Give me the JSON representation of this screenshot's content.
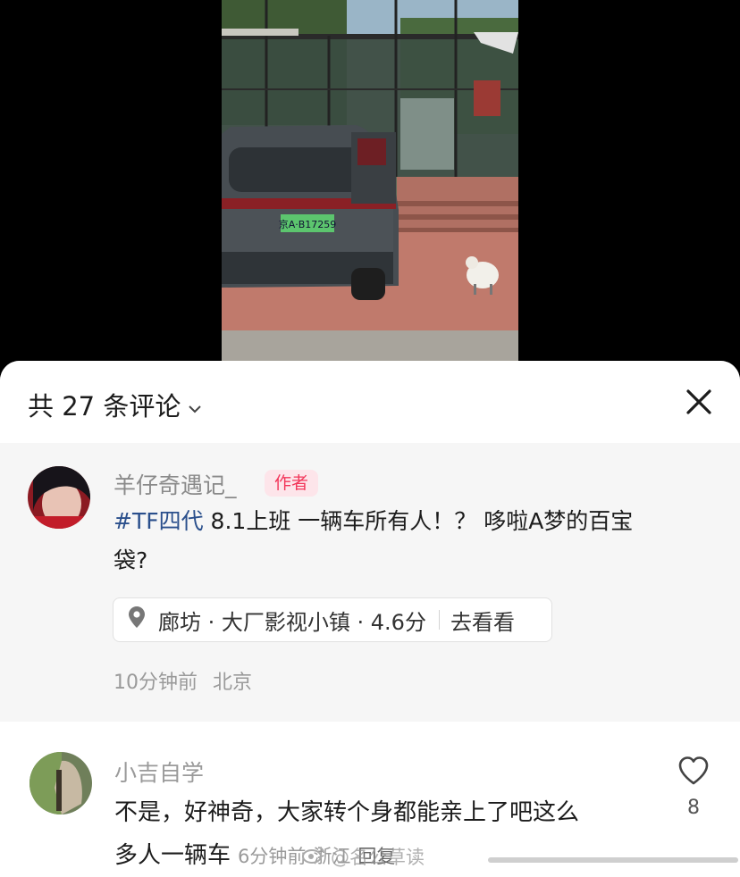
{
  "video": {
    "license_plate": "京A·B17259"
  },
  "header": {
    "comment_count": "共 27 条评论",
    "expand_icon": "chevron-down-icon",
    "close_icon": "close-icon"
  },
  "author_comment": {
    "username": "羊仔奇遇记_",
    "badge": "作者",
    "hashtag": "#TF四代",
    "text_line1": " 8.1上班 一辆车所有人！？ 哆啦A梦的百宝",
    "text_line2": "袋?",
    "location": {
      "icon": "location-pin-icon",
      "name": "廊坊 · 大厂影视小镇 · 4.6分",
      "action": "去看看"
    },
    "time": "10分钟前",
    "region": "北京"
  },
  "comments": [
    {
      "username": "小吉自学",
      "text_line1": "不是，好神奇，大家转个身都能亲上了吧这么",
      "text_line2": "多人一辆车",
      "time": "6分钟前",
      "region": "浙江",
      "reply": "回复",
      "likes": "8",
      "like_icon": "heart-icon"
    }
  ],
  "watermark": "@名公草读",
  "colors": {
    "author_badge_bg": "#fde5ea",
    "author_badge_text": "#f2365a",
    "hashtag": "#2a4f8c",
    "card_bg": "#f6f6f6"
  }
}
